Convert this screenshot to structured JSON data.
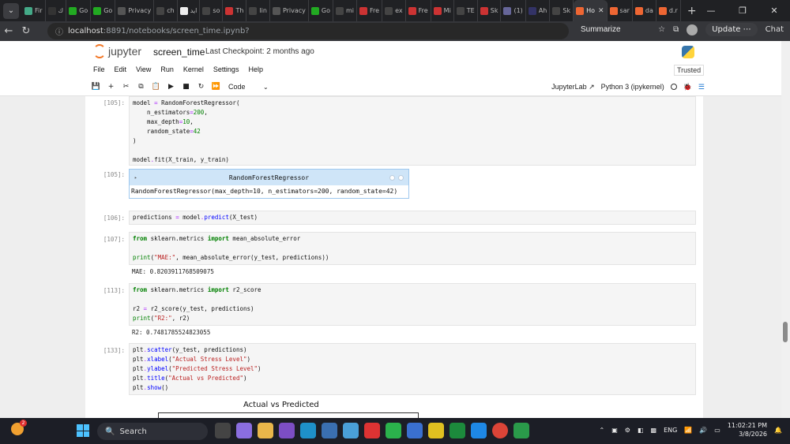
{
  "browser": {
    "tabs": [
      {
        "label": "Fir",
        "color": "#4a8"
      },
      {
        "label": "ك",
        "color": "#333"
      },
      {
        "label": "Go",
        "color": "#2a2"
      },
      {
        "label": "Go",
        "color": "#2a2"
      },
      {
        "label": "Privacy",
        "color": "#555"
      },
      {
        "label": "ch",
        "color": "#444"
      },
      {
        "label": "ايد",
        "color": "#eee"
      },
      {
        "label": "so",
        "color": "#444"
      },
      {
        "label": "Th",
        "color": "#c33"
      },
      {
        "label": "lin",
        "color": "#444"
      },
      {
        "label": "Privacy",
        "color": "#555"
      },
      {
        "label": "Go",
        "color": "#2a2"
      },
      {
        "label": "mi",
        "color": "#444"
      },
      {
        "label": "Fre",
        "color": "#c33"
      },
      {
        "label": "ex",
        "color": "#444"
      },
      {
        "label": "Fre",
        "color": "#c33"
      },
      {
        "label": "Mi",
        "color": "#c33"
      },
      {
        "label": "TE",
        "color": "#444"
      },
      {
        "label": "Sk",
        "color": "#c33"
      },
      {
        "label": "(1)",
        "color": "#669"
      },
      {
        "label": "Ah",
        "color": "#336"
      },
      {
        "label": "Sk",
        "color": "#444"
      },
      {
        "label": "Ho",
        "color": "#e63",
        "active": true
      },
      {
        "label": "sar",
        "color": "#e63"
      },
      {
        "label": "da",
        "color": "#e63"
      },
      {
        "label": "d.r",
        "color": "#e63"
      }
    ],
    "close_tab": "✕",
    "new_tab": "+",
    "window_controls": [
      "—",
      "❐",
      "✕"
    ],
    "url_host": "localhost",
    "url_path": ":8891/notebooks/screen_time.ipynb?",
    "summarize": "Summarize",
    "update": "Update ⋯",
    "chat": "Chat"
  },
  "jupyter": {
    "logo_text": "jupyter",
    "notebook_name": "screen_time",
    "checkpoint": "Last Checkpoint: 2 months ago",
    "trusted": "Trusted",
    "menu": [
      "File",
      "Edit",
      "View",
      "Run",
      "Kernel",
      "Settings",
      "Help"
    ],
    "cell_type": "Code",
    "jupyterlab": "JupyterLab",
    "kernel": "Python 3 (ipykernel)"
  },
  "cells": {
    "c1": {
      "prompt": "[105]:"
    },
    "c1_out": {
      "prompt": "[105]:",
      "header": "RandomForestRegressor",
      "body": "RandomForestRegressor(max_depth=10, n_estimators=200, random_state=42)"
    },
    "c2": {
      "prompt": "[106]:"
    },
    "c3": {
      "prompt": "[107]:",
      "output": "MAE: 0.8203911768509075"
    },
    "c4": {
      "prompt": "[113]:",
      "output": "R2: 0.7481785524823055"
    },
    "c5": {
      "prompt": "[133]:"
    }
  },
  "plot": {
    "title": "Actual vs Predicted"
  },
  "taskbar": {
    "search": "Search",
    "lang": "ENG",
    "time": "11:02:21 PM",
    "date": "3/8/2026",
    "badge": "2"
  }
}
